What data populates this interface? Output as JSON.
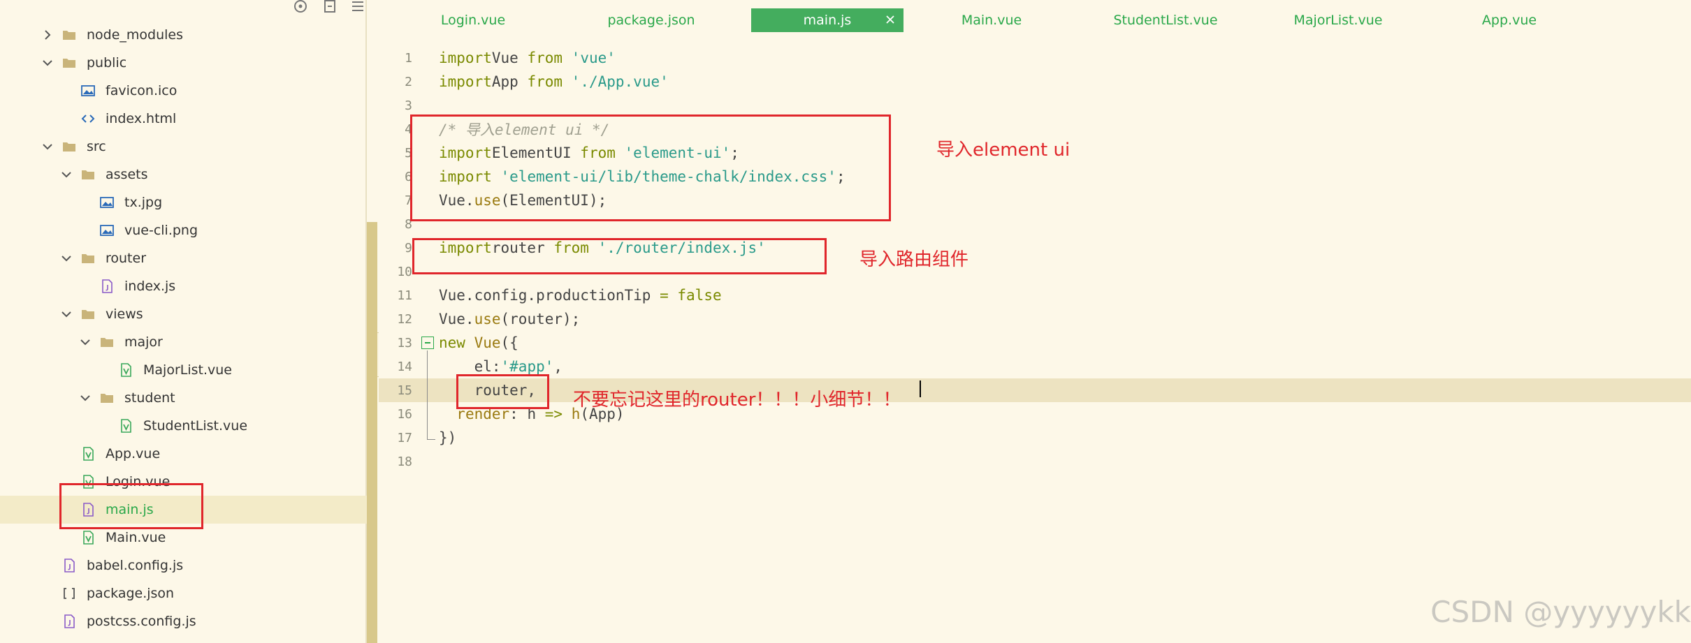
{
  "sidebar": {
    "tools": [
      {
        "icon": "crosshair-icon"
      },
      {
        "icon": "collapse-all-icon"
      },
      {
        "icon": "menu-icon"
      }
    ],
    "tree": [
      {
        "label": "node_modules",
        "type": "folder",
        "depth": 1,
        "expanded": false
      },
      {
        "label": "public",
        "type": "folder",
        "depth": 1,
        "expanded": true
      },
      {
        "label": "favicon.ico",
        "type": "image",
        "depth": 2
      },
      {
        "label": "index.html",
        "type": "html",
        "depth": 2
      },
      {
        "label": "src",
        "type": "folder",
        "depth": 1,
        "expanded": true
      },
      {
        "label": "assets",
        "type": "folder",
        "depth": 2,
        "expanded": true
      },
      {
        "label": "tx.jpg",
        "type": "image",
        "depth": 3
      },
      {
        "label": "vue-cli.png",
        "type": "image",
        "depth": 3
      },
      {
        "label": "router",
        "type": "folder",
        "depth": 2,
        "expanded": true
      },
      {
        "label": "index.js",
        "type": "js",
        "depth": 3
      },
      {
        "label": "views",
        "type": "folder",
        "depth": 2,
        "expanded": true
      },
      {
        "label": "major",
        "type": "folder",
        "depth": 3,
        "expanded": true
      },
      {
        "label": "MajorList.vue",
        "type": "vue",
        "depth": 4
      },
      {
        "label": "student",
        "type": "folder",
        "depth": 3,
        "expanded": true
      },
      {
        "label": "StudentList.vue",
        "type": "vue",
        "depth": 4
      },
      {
        "label": "App.vue",
        "type": "vue",
        "depth": 2
      },
      {
        "label": "Login.vue",
        "type": "vue",
        "depth": 2
      },
      {
        "label": "main.js",
        "type": "js",
        "depth": 2,
        "selected": true
      },
      {
        "label": "Main.vue",
        "type": "vue",
        "depth": 2
      },
      {
        "label": "babel.config.js",
        "type": "js",
        "depth": 1
      },
      {
        "label": "package.json",
        "type": "json",
        "depth": 1
      },
      {
        "label": "postcss.config.js",
        "type": "js",
        "depth": 1
      }
    ]
  },
  "tabs": [
    {
      "label": "Login.vue",
      "active": false
    },
    {
      "label": "package.json",
      "active": false
    },
    {
      "label": "main.js",
      "active": true
    },
    {
      "label": "Main.vue",
      "active": false
    },
    {
      "label": "StudentList.vue",
      "active": false
    },
    {
      "label": "MajorList.vue",
      "active": false
    },
    {
      "label": "App.vue",
      "active": false
    }
  ],
  "code": [
    {
      "n": "1",
      "tokens": [
        [
          "kw",
          "import"
        ],
        [
          "",
          "Vue "
        ],
        [
          "kw",
          "from"
        ],
        [
          "",
          " "
        ],
        [
          "str",
          "'vue'"
        ]
      ]
    },
    {
      "n": "2",
      "tokens": [
        [
          "kw",
          "import"
        ],
        [
          "",
          "App "
        ],
        [
          "kw",
          "from"
        ],
        [
          "",
          " "
        ],
        [
          "str",
          "'./App.vue'"
        ]
      ]
    },
    {
      "n": "3",
      "tokens": []
    },
    {
      "n": "4",
      "tokens": [
        [
          "cm",
          "/* 导入element ui */"
        ]
      ]
    },
    {
      "n": "5",
      "tokens": [
        [
          "kw",
          "import"
        ],
        [
          "",
          "ElementUI "
        ],
        [
          "kw",
          "from"
        ],
        [
          "",
          " "
        ],
        [
          "str",
          "'element-ui'"
        ],
        [
          "",
          ";"
        ]
      ]
    },
    {
      "n": "6",
      "tokens": [
        [
          "kw",
          "import"
        ],
        [
          "",
          " "
        ],
        [
          "str",
          "'element-ui/lib/theme-chalk/index.css'"
        ],
        [
          "",
          ";"
        ]
      ]
    },
    {
      "n": "7",
      "tokens": [
        [
          "",
          "Vue."
        ],
        [
          "fn",
          "use"
        ],
        [
          "",
          "(ElementUI);"
        ]
      ]
    },
    {
      "n": "8",
      "tokens": []
    },
    {
      "n": "9",
      "tokens": [
        [
          "kw",
          "import"
        ],
        [
          "",
          "router "
        ],
        [
          "kw",
          "from"
        ],
        [
          "",
          " "
        ],
        [
          "str",
          "'./router/index.js'"
        ]
      ]
    },
    {
      "n": "10",
      "tokens": []
    },
    {
      "n": "11",
      "tokens": [
        [
          "",
          "Vue.config.productionTip "
        ],
        [
          "kw",
          "="
        ],
        [
          "",
          " "
        ],
        [
          "kw",
          "false"
        ]
      ]
    },
    {
      "n": "12",
      "tokens": [
        [
          "",
          "Vue."
        ],
        [
          "fn",
          "use"
        ],
        [
          "",
          "(router);"
        ]
      ]
    },
    {
      "n": "13",
      "tokens": [
        [
          "kw",
          "new"
        ],
        [
          "",
          " "
        ],
        [
          "fn",
          "Vue"
        ],
        [
          "",
          "({"
        ]
      ]
    },
    {
      "n": "14",
      "tokens": [
        [
          "",
          "    el:"
        ],
        [
          "str",
          "'#app'"
        ],
        [
          "",
          ","
        ]
      ]
    },
    {
      "n": "15",
      "tokens": [
        [
          "",
          "    router,"
        ]
      ],
      "current": true
    },
    {
      "n": "16",
      "tokens": [
        [
          "",
          "  "
        ],
        [
          "fn",
          "render"
        ],
        [
          "",
          ": h "
        ],
        [
          "kw",
          "=>"
        ],
        [
          "",
          " "
        ],
        [
          "fn",
          "h"
        ],
        [
          "",
          "(App)"
        ]
      ]
    },
    {
      "n": "17",
      "tokens": [
        [
          "",
          "})"
        ]
      ]
    },
    {
      "n": "18",
      "tokens": []
    }
  ],
  "annotations": {
    "element_ui": "导入element ui",
    "router_import": "导入路由组件",
    "router_reminder": "不要忘记这里的router！！！小细节！！"
  },
  "watermark": "CSDN @yyyyyykk",
  "colors": {
    "background": "#fdf8e8",
    "accent_green": "#2aa84a",
    "active_tab": "#44ad5e",
    "annotation_red": "#e0262b"
  }
}
